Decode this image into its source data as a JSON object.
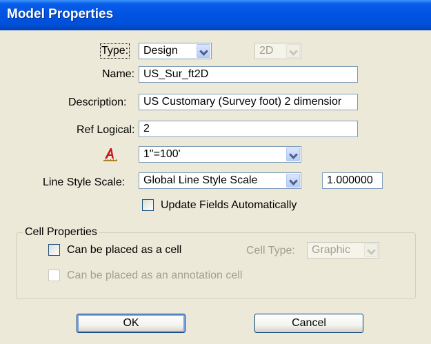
{
  "window": {
    "title": "Model Properties"
  },
  "form": {
    "type_label": "Type:",
    "type_value": "Design",
    "dimension_value": "2D",
    "name_label": "Name:",
    "name_value": "US_Sur_ft2D",
    "description_label": "Description:",
    "description_value": "US Customary (Survey foot) 2 dimensior",
    "ref_logical_label": "Ref Logical:",
    "ref_logical_value": "2",
    "annotation_scale_value": "1\"=100'",
    "line_style_scale_label": "Line Style Scale:",
    "line_style_scale_value": "Global Line Style Scale",
    "line_style_scale_number": "1.000000",
    "update_fields_label": "Update Fields Automatically"
  },
  "cell_properties": {
    "group_title": "Cell Properties",
    "placed_as_cell_label": "Can be placed as a cell",
    "cell_type_label": "Cell Type:",
    "cell_type_value": "Graphic",
    "annotation_cell_label": "Can be placed as an annotation cell"
  },
  "buttons": {
    "ok": "OK",
    "cancel": "Cancel"
  },
  "colors": {
    "titlebar": "#0054e3",
    "dialog_bg": "#ece9d8",
    "field_border": "#7f9db9"
  },
  "icons": {
    "annotation_scale": "annotation-scale-icon",
    "dropdown": "chevron-down-icon"
  }
}
